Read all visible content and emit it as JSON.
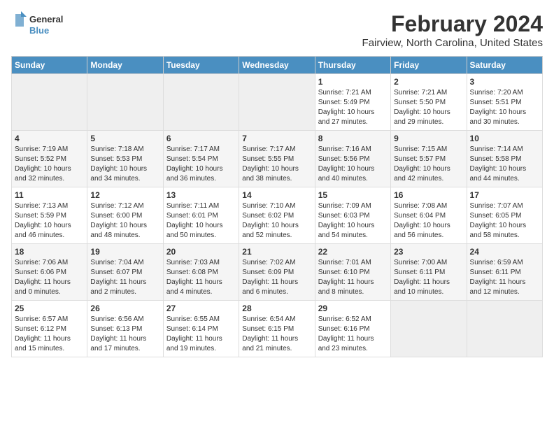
{
  "header": {
    "logo_line1": "General",
    "logo_line2": "Blue",
    "title": "February 2024",
    "subtitle": "Fairview, North Carolina, United States"
  },
  "days_of_week": [
    "Sunday",
    "Monday",
    "Tuesday",
    "Wednesday",
    "Thursday",
    "Friday",
    "Saturday"
  ],
  "weeks": [
    [
      {
        "day": "",
        "info": ""
      },
      {
        "day": "",
        "info": ""
      },
      {
        "day": "",
        "info": ""
      },
      {
        "day": "",
        "info": ""
      },
      {
        "day": "1",
        "info": "Sunrise: 7:21 AM\nSunset: 5:49 PM\nDaylight: 10 hours\nand 27 minutes."
      },
      {
        "day": "2",
        "info": "Sunrise: 7:21 AM\nSunset: 5:50 PM\nDaylight: 10 hours\nand 29 minutes."
      },
      {
        "day": "3",
        "info": "Sunrise: 7:20 AM\nSunset: 5:51 PM\nDaylight: 10 hours\nand 30 minutes."
      }
    ],
    [
      {
        "day": "4",
        "info": "Sunrise: 7:19 AM\nSunset: 5:52 PM\nDaylight: 10 hours\nand 32 minutes."
      },
      {
        "day": "5",
        "info": "Sunrise: 7:18 AM\nSunset: 5:53 PM\nDaylight: 10 hours\nand 34 minutes."
      },
      {
        "day": "6",
        "info": "Sunrise: 7:17 AM\nSunset: 5:54 PM\nDaylight: 10 hours\nand 36 minutes."
      },
      {
        "day": "7",
        "info": "Sunrise: 7:17 AM\nSunset: 5:55 PM\nDaylight: 10 hours\nand 38 minutes."
      },
      {
        "day": "8",
        "info": "Sunrise: 7:16 AM\nSunset: 5:56 PM\nDaylight: 10 hours\nand 40 minutes."
      },
      {
        "day": "9",
        "info": "Sunrise: 7:15 AM\nSunset: 5:57 PM\nDaylight: 10 hours\nand 42 minutes."
      },
      {
        "day": "10",
        "info": "Sunrise: 7:14 AM\nSunset: 5:58 PM\nDaylight: 10 hours\nand 44 minutes."
      }
    ],
    [
      {
        "day": "11",
        "info": "Sunrise: 7:13 AM\nSunset: 5:59 PM\nDaylight: 10 hours\nand 46 minutes."
      },
      {
        "day": "12",
        "info": "Sunrise: 7:12 AM\nSunset: 6:00 PM\nDaylight: 10 hours\nand 48 minutes."
      },
      {
        "day": "13",
        "info": "Sunrise: 7:11 AM\nSunset: 6:01 PM\nDaylight: 10 hours\nand 50 minutes."
      },
      {
        "day": "14",
        "info": "Sunrise: 7:10 AM\nSunset: 6:02 PM\nDaylight: 10 hours\nand 52 minutes."
      },
      {
        "day": "15",
        "info": "Sunrise: 7:09 AM\nSunset: 6:03 PM\nDaylight: 10 hours\nand 54 minutes."
      },
      {
        "day": "16",
        "info": "Sunrise: 7:08 AM\nSunset: 6:04 PM\nDaylight: 10 hours\nand 56 minutes."
      },
      {
        "day": "17",
        "info": "Sunrise: 7:07 AM\nSunset: 6:05 PM\nDaylight: 10 hours\nand 58 minutes."
      }
    ],
    [
      {
        "day": "18",
        "info": "Sunrise: 7:06 AM\nSunset: 6:06 PM\nDaylight: 11 hours\nand 0 minutes."
      },
      {
        "day": "19",
        "info": "Sunrise: 7:04 AM\nSunset: 6:07 PM\nDaylight: 11 hours\nand 2 minutes."
      },
      {
        "day": "20",
        "info": "Sunrise: 7:03 AM\nSunset: 6:08 PM\nDaylight: 11 hours\nand 4 minutes."
      },
      {
        "day": "21",
        "info": "Sunrise: 7:02 AM\nSunset: 6:09 PM\nDaylight: 11 hours\nand 6 minutes."
      },
      {
        "day": "22",
        "info": "Sunrise: 7:01 AM\nSunset: 6:10 PM\nDaylight: 11 hours\nand 8 minutes."
      },
      {
        "day": "23",
        "info": "Sunrise: 7:00 AM\nSunset: 6:11 PM\nDaylight: 11 hours\nand 10 minutes."
      },
      {
        "day": "24",
        "info": "Sunrise: 6:59 AM\nSunset: 6:11 PM\nDaylight: 11 hours\nand 12 minutes."
      }
    ],
    [
      {
        "day": "25",
        "info": "Sunrise: 6:57 AM\nSunset: 6:12 PM\nDaylight: 11 hours\nand 15 minutes."
      },
      {
        "day": "26",
        "info": "Sunrise: 6:56 AM\nSunset: 6:13 PM\nDaylight: 11 hours\nand 17 minutes."
      },
      {
        "day": "27",
        "info": "Sunrise: 6:55 AM\nSunset: 6:14 PM\nDaylight: 11 hours\nand 19 minutes."
      },
      {
        "day": "28",
        "info": "Sunrise: 6:54 AM\nSunset: 6:15 PM\nDaylight: 11 hours\nand 21 minutes."
      },
      {
        "day": "29",
        "info": "Sunrise: 6:52 AM\nSunset: 6:16 PM\nDaylight: 11 hours\nand 23 minutes."
      },
      {
        "day": "",
        "info": ""
      },
      {
        "day": "",
        "info": ""
      }
    ]
  ]
}
